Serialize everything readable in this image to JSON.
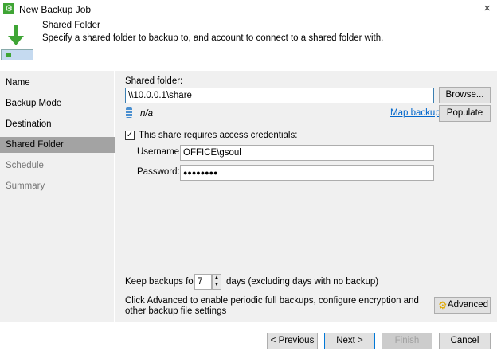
{
  "window": {
    "title": "New Backup Job",
    "close_icon": "×"
  },
  "header": {
    "title": "Shared Folder",
    "description": "Specify a shared folder to backup to, and account to connect to a shared folder with."
  },
  "sidebar": {
    "items": [
      {
        "label": "Name",
        "state": "normal"
      },
      {
        "label": "Backup Mode",
        "state": "normal"
      },
      {
        "label": "Destination",
        "state": "normal"
      },
      {
        "label": "Shared Folder",
        "state": "selected"
      },
      {
        "label": "Schedule",
        "state": "disabled"
      },
      {
        "label": "Summary",
        "state": "disabled"
      }
    ]
  },
  "main": {
    "shared_folder_label": "Shared folder:",
    "shared_folder_value": "\\\\10.0.0.1\\share",
    "browse_label": "Browse...",
    "status_text": "n/a",
    "map_backup_link": "Map backup",
    "populate_label": "Populate",
    "credentials_checkbox_label": "This share requires access credentials:",
    "credentials_checked": true,
    "username_label": "Username:",
    "username_value": "OFFICE\\gsoul",
    "password_label": "Password:",
    "password_value": "●●●●●●●●",
    "keep_label": "Keep backups for:",
    "keep_value": "7",
    "keep_suffix": "days (excluding days with no backup)",
    "advanced_text": "Click Advanced to enable periodic full backups, configure encryption and other backup file settings",
    "advanced_label": "Advanced"
  },
  "footer": {
    "previous": "< Previous",
    "next": "Next >",
    "finish": "Finish",
    "cancel": "Cancel"
  },
  "colors": {
    "accent_green": "#3fa535",
    "link": "#0066cc",
    "selected_bg": "#a3a3a3"
  }
}
